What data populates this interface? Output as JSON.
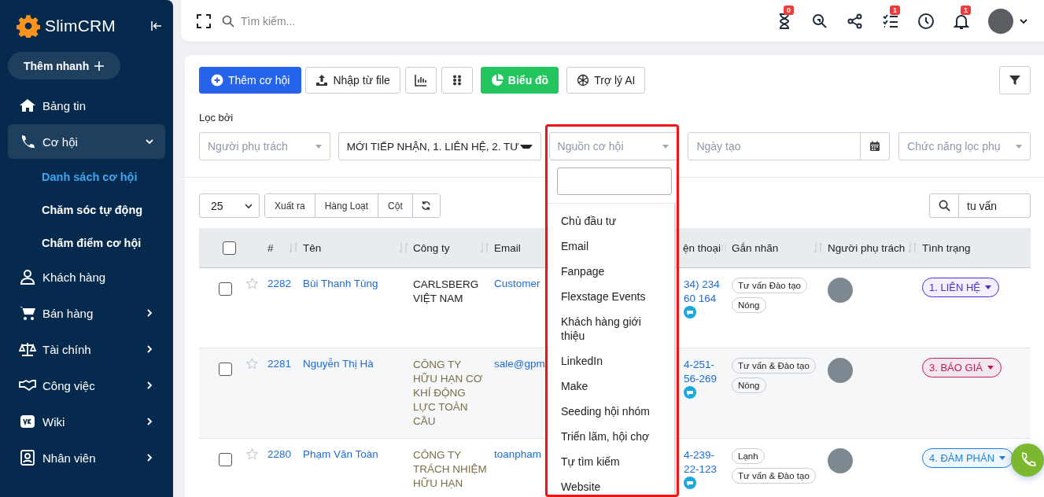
{
  "sidebar": {
    "logo": "SlimCRM",
    "quick_add": "Thêm nhanh",
    "items": [
      {
        "label": "Bảng tin",
        "kind": "link",
        "selected": false
      },
      {
        "label": "Cơ hội",
        "kind": "group",
        "selected": true,
        "expanded": true,
        "children": [
          {
            "label": "Danh sách cơ hội",
            "selected": true
          },
          {
            "label": "Chăm sóc tự động",
            "selected": false
          },
          {
            "label": "Chấm điểm cơ hội",
            "selected": false
          }
        ]
      },
      {
        "label": "Khách hàng",
        "kind": "link",
        "selected": false
      },
      {
        "label": "Bán hàng",
        "kind": "group",
        "selected": false,
        "expanded": false
      },
      {
        "label": "Tài chính",
        "kind": "group",
        "selected": false,
        "expanded": false
      },
      {
        "label": "Công việc",
        "kind": "group",
        "selected": false,
        "expanded": false
      },
      {
        "label": "Wiki",
        "kind": "group",
        "selected": false,
        "expanded": false
      },
      {
        "label": "Nhân viên",
        "kind": "group",
        "selected": false,
        "expanded": false
      }
    ]
  },
  "topbar": {
    "search": {
      "placeholder": "Tìm kiếm..."
    },
    "timer_badge": "0",
    "tasks_badge": "1",
    "notifications_badge": "1"
  },
  "toolbar": {
    "add_button": "Thêm cơ hội",
    "import_button": "Nhập từ file",
    "chart_button": "Biểu đồ",
    "ai_button": "Trợ lý AI"
  },
  "filters": {
    "label": "Lọc bởi",
    "owner": {
      "placeholder": "Người phụ trách"
    },
    "status": {
      "value": "MỚI TIẾP NHẬN, 1. LIÊN HỆ, 2. TƯ"
    },
    "source": {
      "placeholder": "Nguồn cơ hội"
    },
    "created": {
      "placeholder": "Ngày tạo"
    },
    "extra": {
      "placeholder": "Chức năng lọc phụ"
    }
  },
  "source_dropdown": {
    "options": [
      "Chủ đầu tư",
      "Email",
      "Fanpage",
      "Flexstage Events",
      "Khách hàng giới thiệu",
      "LinkedIn",
      "Make",
      "Seeding hội nhóm",
      "Triển lãm, hội chợ",
      "Tự tìm kiếm",
      "Website"
    ]
  },
  "table_controls": {
    "page_size": "25",
    "buttons": [
      "Xuất ra",
      "Hàng Loạt",
      "Cột"
    ],
    "search": {
      "value": "tu vấn"
    }
  },
  "table": {
    "header_checked": false,
    "columns": [
      {
        "label": "#",
        "sortable": true
      },
      {
        "label": "Tên",
        "sortable": true
      },
      {
        "label": "Công ty",
        "sortable": true
      },
      {
        "label": "Email",
        "sortable": false
      },
      {
        "label": "ện thoại",
        "sortable": true
      },
      {
        "label": "Gắn nhãn",
        "sortable": true
      },
      {
        "label": "Người phụ trách",
        "sortable": true
      },
      {
        "label": "Tình trạng",
        "sortable": false
      }
    ],
    "rows": [
      {
        "checked": false,
        "starred": false,
        "id": "2282",
        "name": "Bùi Thanh Tùng",
        "company": "CARLSBERG VIỆT NAM",
        "email": "Customer",
        "phone": [
          "34) 234",
          "60 164"
        ],
        "tags": [
          "Tư vấn Đào tạo",
          "Nóng"
        ],
        "status": "1. LIÊN HỆ",
        "color": "#4b2fd6"
      },
      {
        "checked": false,
        "starred": false,
        "id": "2281",
        "name": "Nguyễn Thị Hà",
        "company": "CÔNG TY HỮU HẠN CƠ KHÍ ĐỘNG LỰC TOÀN CẦU",
        "email": "sale@gpm",
        "phone": [
          "4-251-",
          "56-269"
        ],
        "tags": [
          "Tư vấn & Đào tạo",
          "Nóng"
        ],
        "status": "3. BÁO GIÁ",
        "color": "#c2185b"
      },
      {
        "checked": false,
        "starred": false,
        "id": "2280",
        "name": "Phạm Văn Toàn",
        "company": "CÔNG TY TRÁCH NHIỆM HỮU HẠN",
        "email": "toanpham",
        "phone": [
          "4-239-",
          "22-123"
        ],
        "tags": [
          "Lạnh",
          "Tư vấn & Đào tạo"
        ],
        "status": "4. ĐÀM PHÁN",
        "color": "#1e7fd8"
      }
    ]
  }
}
